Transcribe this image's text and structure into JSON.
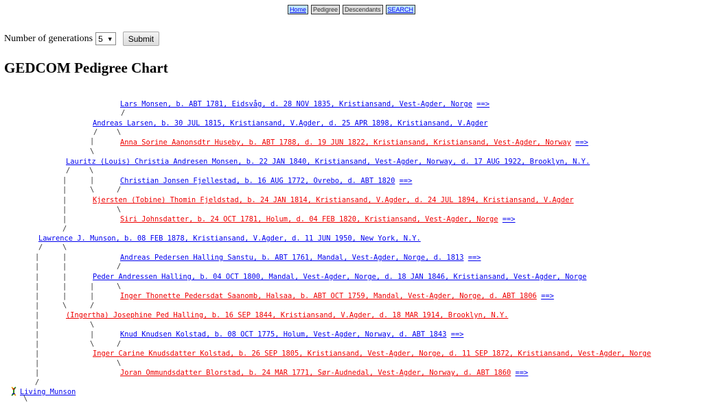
{
  "nav": {
    "home": "Home",
    "pedigree": "Pedigree",
    "descendants": "Descendants",
    "search": "SEARCH"
  },
  "form": {
    "generations_label": "Number of generations",
    "generations_value": "5",
    "submit_label": "Submit"
  },
  "page_title": "GEDCOM Pedigree Chart",
  "more_marker": "==>",
  "people": {
    "p1": "Lars Monsen, b. ABT 1781, Eidsvåg, d. 28 NOV 1835, Kristiansand, Vest-Agder, Norge",
    "p2": "Andreas Larsen, b. 30 JUL 1815, Kristiansand, V.Agder, d. 25 APR 1898, Kristiansand, V.Agder",
    "p3": "Anna Sorine Aanonsdtr Huseby, b. ABT 1788, d. 19 JUN 1822, Kristiansand, Kristiansand, Vest-Agder, Norway",
    "p4": "Lauritz (Louis) Christia Andresen Monsen, b. 22 JAN 1840, Kristiansand, Vest-Agder, Norway, d. 17 AUG 1922, Brooklyn, N.Y.",
    "p5": "Christian Jonsen Fjellestad, b. 16 AUG 1772, Ovrebo, d. ABT 1820",
    "p6": "Kjersten (Tobine) Thomin Fjeldstad, b. 24 JAN 1814, Kristiansand, V.Agder, d. 24 JUL 1894, Kristiansand, V.Agder",
    "p7": "Siri Johnsdatter, b. 24 OCT 1781, Holum, d. 04 FEB 1820, Kristiansand, Vest-Agder, Norge",
    "p8": "Lawrence J. Munson, b. 08 FEB 1878, Kristiansand, V.Agder, d. 11 JUN 1950, New York, N.Y.",
    "p9": "Andreas Pedersen Halling Sanstu, b. ABT 1761, Mandal, Vest-Agder, Norge, d. 1813",
    "p10": "Peder Andressen Halling, b. 04 OCT 1800, Mandal, Vest-Agder, Norge, d. 18 JAN 1846, Kristiansand, Vest-Agder, Norge",
    "p11": "Inger Thonette Pedersdat Saanomb, Halsaa, b. ABT OCT 1759, Mandal, Vest-Agder, Norge, d. ABT 1806",
    "p12": "(Ingertha) Josephine Ped Halling, b. 16 SEP 1844, Kristiansand, V.Agder, d. 18 MAR 1914, Brooklyn, N.Y.",
    "p13": "Knud Knudsen Kolstad, b. 08 OCT 1775, Holum, Vest-Agder, Norway, d. ABT 1843",
    "p14": "Inger Carine Knudsdatter Kolstad, b. 26 SEP 1805, Kristiansand, Vest-Agder, Norge, d. 11 SEP 1872, Kristiansand, Vest-Agder, Norge",
    "p15": "Joran Ommundsdatter Blorstad, b. 24 MAR 1771, Sør-Audnedal, Vest-Agder, Norway, d. ABT 1860",
    "p16": "Living Munson"
  },
  "colors": {
    "male_link": "#0000ee",
    "female_link": "#ee0000",
    "connector": "#333333"
  },
  "icons": {
    "root_icon": "dna-icon"
  }
}
